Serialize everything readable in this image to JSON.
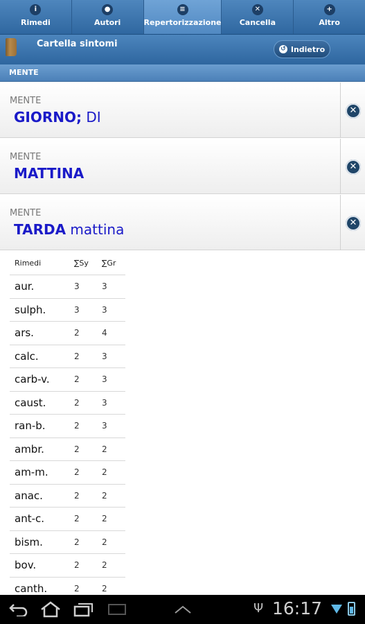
{
  "tabs": [
    {
      "label": "Rimedi",
      "icon": "info-icon",
      "glyph": "i"
    },
    {
      "label": "Autori",
      "icon": "person-icon",
      "glyph": "●"
    },
    {
      "label": "Repertorizzazione",
      "icon": "list-icon",
      "glyph": "≡",
      "active": true
    },
    {
      "label": "Cancella",
      "icon": "delete-icon",
      "glyph": "✕"
    },
    {
      "label": "Altro",
      "icon": "plus-icon",
      "glyph": "+"
    }
  ],
  "subheader": {
    "title": "Cartella sintomi",
    "back_label": "Indietro"
  },
  "section": {
    "label": "MENTE"
  },
  "symptoms": [
    {
      "category": "MENTE",
      "main": "GIORNO;",
      "rest": " DI"
    },
    {
      "category": "MENTE",
      "main": "MATTINA",
      "rest": ""
    },
    {
      "category": "MENTE",
      "main": "TARDA",
      "rest": " mattina"
    }
  ],
  "results": {
    "headers": {
      "name": "Rimedi",
      "sy": "∑Sy",
      "gr": "∑Gr"
    },
    "rows": [
      {
        "name": "aur.",
        "sy": "3",
        "gr": "3"
      },
      {
        "name": "sulph.",
        "sy": "3",
        "gr": "3"
      },
      {
        "name": "ars.",
        "sy": "2",
        "gr": "4"
      },
      {
        "name": "calc.",
        "sy": "2",
        "gr": "3"
      },
      {
        "name": "carb-v.",
        "sy": "2",
        "gr": "3"
      },
      {
        "name": "caust.",
        "sy": "2",
        "gr": "3"
      },
      {
        "name": "ran-b.",
        "sy": "2",
        "gr": "3"
      },
      {
        "name": "ambr.",
        "sy": "2",
        "gr": "2"
      },
      {
        "name": "am-m.",
        "sy": "2",
        "gr": "2"
      },
      {
        "name": "anac.",
        "sy": "2",
        "gr": "2"
      },
      {
        "name": "ant-c.",
        "sy": "2",
        "gr": "2"
      },
      {
        "name": "bism.",
        "sy": "2",
        "gr": "2"
      },
      {
        "name": "bov.",
        "sy": "2",
        "gr": "2"
      },
      {
        "name": "canth.",
        "sy": "2",
        "gr": "2"
      }
    ]
  },
  "system_bar": {
    "time": "16:17"
  },
  "colors": {
    "accent": "#2f67a0",
    "symptom_text": "#1a1ac8"
  }
}
